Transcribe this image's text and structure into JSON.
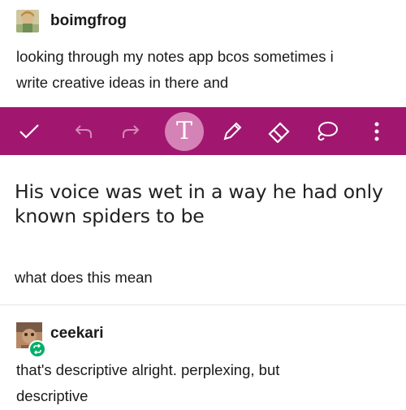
{
  "post": {
    "username": "boimgfrog",
    "text_line1": "looking through my notes app bcos sometimes i",
    "text_line2": "write creative ideas in there and"
  },
  "toolbar": {
    "color": "#a1176f",
    "icons": [
      "check-icon",
      "undo-icon",
      "redo-icon",
      "text-tool-icon",
      "pen-icon",
      "eraser-icon",
      "lasso-icon",
      "more-icon"
    ],
    "text_tool_glyph": "T"
  },
  "note": {
    "line1": "His voice was wet in a way he had only",
    "line2": "known spiders to be"
  },
  "caption": "what does this mean",
  "reply": {
    "username": "ceekari",
    "text_line1": "that's descriptive alright. perplexing, but",
    "text_line2": "descriptive"
  }
}
